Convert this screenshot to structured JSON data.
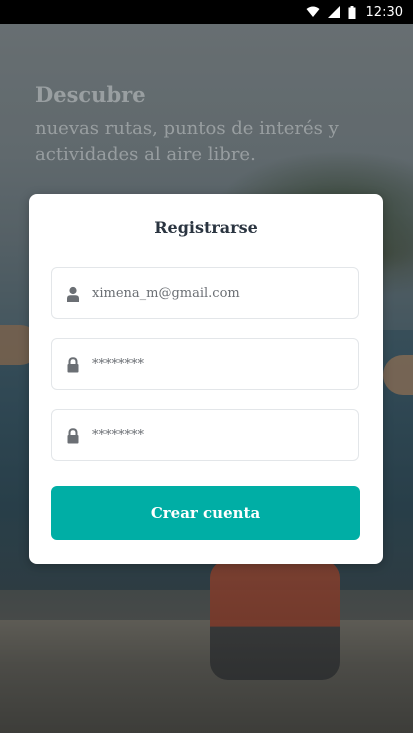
{
  "status_bar": {
    "time": "12:30",
    "icons": [
      "wifi-icon",
      "signal-icon",
      "sim-icon",
      "battery-icon"
    ]
  },
  "hero": {
    "title": "Descubre",
    "subtitle": "nuevas rutas, puntos de interés y actividades al aire libre."
  },
  "form": {
    "title": "Registrarse",
    "email": {
      "value": "ximena_m@gmail.com",
      "icon": "user-icon"
    },
    "password": {
      "value": "********",
      "icon": "lock-icon"
    },
    "password_confirm": {
      "value": "********",
      "icon": "lock-icon"
    },
    "submit_label": "Crear cuenta"
  },
  "colors": {
    "accent": "#00aea5",
    "title_text": "#2a3440",
    "field_text": "#6b6f74",
    "status_bar": "#000000"
  }
}
